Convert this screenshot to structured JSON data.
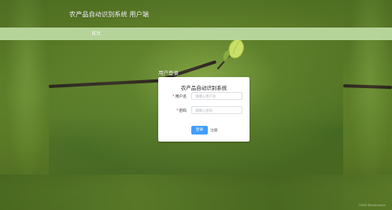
{
  "header": {
    "title": "农产品自动识别系统 用户端"
  },
  "nav": {
    "items": [
      {
        "label": "首页"
      }
    ]
  },
  "login": {
    "section_label": "用户登录",
    "card_title": "农产品自动识别系统",
    "fields": {
      "username": {
        "label": "用户名",
        "placeholder": "请输入用户名",
        "required_mark": "*"
      },
      "password": {
        "label": "密码",
        "placeholder": "请输入密码",
        "required_mark": "*"
      }
    },
    "buttons": {
      "login": "登录",
      "register": "注册"
    }
  },
  "footer": {
    "watermark": "CSDN @biyezuopin"
  },
  "colors": {
    "navbar": "#b7d69c",
    "primary_button": "#409eff",
    "background_green": "#6f8f2f"
  }
}
